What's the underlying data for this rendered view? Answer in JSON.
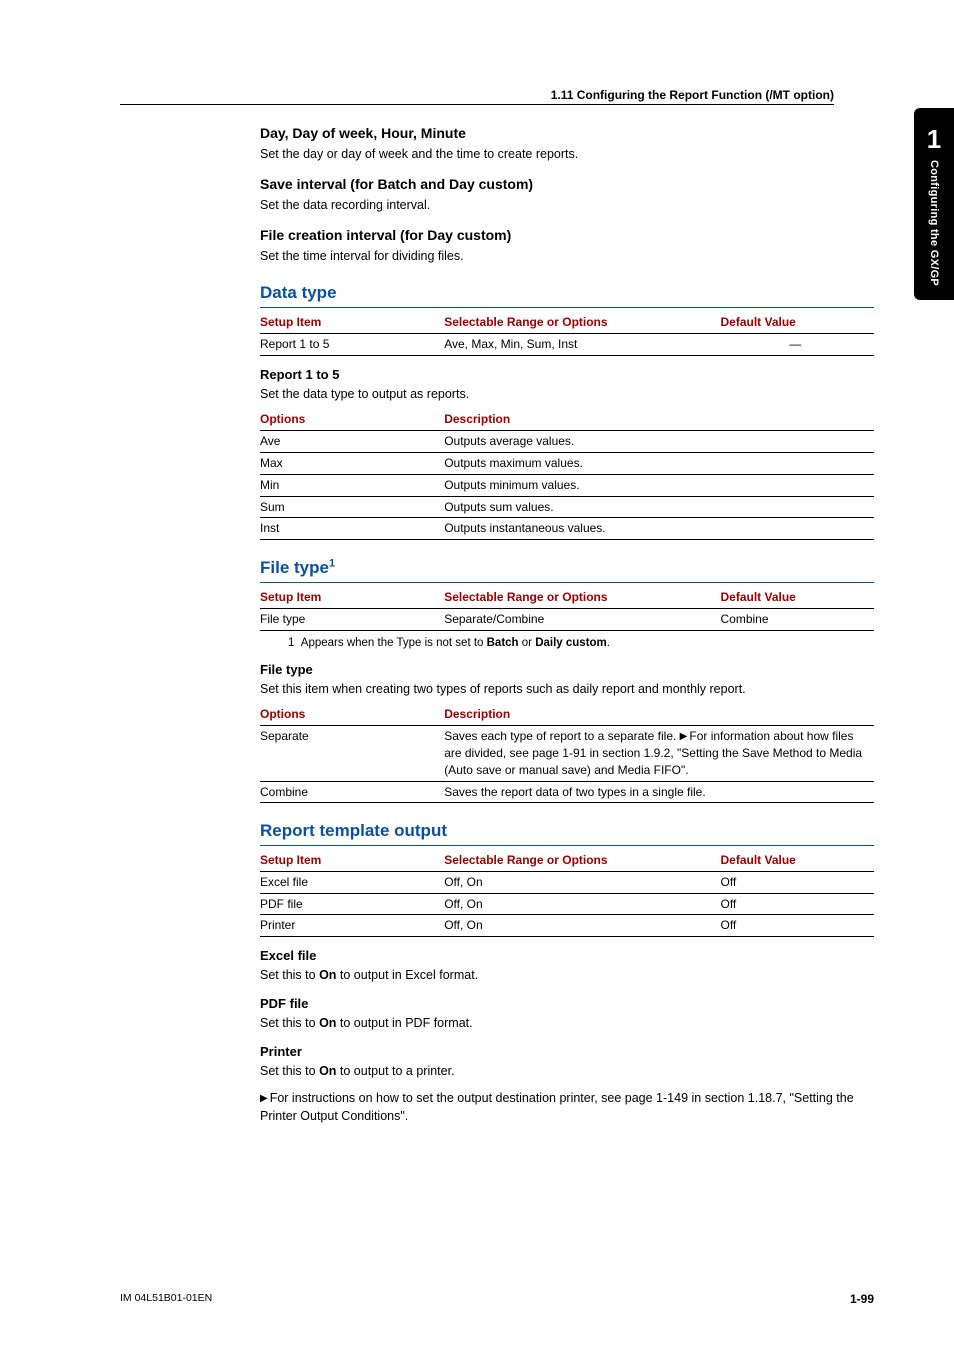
{
  "header": {
    "running": "1.11  Configuring the Report Function (/MT option)"
  },
  "sidetab": {
    "chapter": "1",
    "label": "Configuring the GX/GP"
  },
  "sections": {
    "dayhour": {
      "title": "Day, Day of week, Hour, Minute",
      "desc": "Set the day or day of week and the time to create reports."
    },
    "saveint": {
      "title": "Save interval (for Batch and Day custom)",
      "desc": "Set the data recording interval."
    },
    "fileint": {
      "title": "File creation interval (for Day custom)",
      "desc": "Set the time interval for dividing files."
    },
    "datatype": {
      "title": "Data type",
      "table_headers": {
        "setup": "Setup Item",
        "range": "Selectable Range or Options",
        "default": "Default Value"
      },
      "rows": [
        {
          "item": "Report 1 to 5",
          "range": "Ave, Max, Min, Sum, Inst",
          "default": "—"
        }
      ],
      "subhead": "Report 1 to 5",
      "subdesc": "Set the data type to output as reports.",
      "opts_headers": {
        "opt": "Options",
        "desc": "Description"
      },
      "opts": [
        {
          "o": "Ave",
          "d": "Outputs average values."
        },
        {
          "o": "Max",
          "d": "Outputs maximum values."
        },
        {
          "o": "Min",
          "d": "Outputs minimum values."
        },
        {
          "o": "Sum",
          "d": "Outputs sum values."
        },
        {
          "o": "Inst",
          "d": "Outputs instantaneous values."
        }
      ]
    },
    "filetype": {
      "title": "File type",
      "sup": "1",
      "table_headers": {
        "setup": "Setup Item",
        "range": "Selectable Range or Options",
        "default": "Default Value"
      },
      "rows": [
        {
          "item": "File type",
          "range": "Separate/Combine",
          "default": "Combine"
        }
      ],
      "footnote_prefix": "1",
      "footnote_a": "Appears when the Type is not set to ",
      "footnote_b1": "Batch",
      "footnote_mid": " or ",
      "footnote_b2": "Daily custom",
      "footnote_end": ".",
      "subhead": "File type",
      "subdesc": "Set this item when creating two types of reports such as daily report and monthly report.",
      "opts_headers": {
        "opt": "Options",
        "desc": "Description"
      },
      "opts": {
        "sep_o": "Separate",
        "sep_d1": "Saves each type of report to a separate file. ",
        "sep_d2": "For information about how files are divided, see page 1-91 in section 1.9.2, \"Setting the Save Method to Media (Auto save or manual save) and Media FIFO\".",
        "comb_o": "Combine",
        "comb_d": "Saves the report data of two types in a single file."
      }
    },
    "template": {
      "title": "Report template output",
      "table_headers": {
        "setup": "Setup Item",
        "range": "Selectable Range or Options",
        "default": "Default Value"
      },
      "rows": [
        {
          "item": "Excel file",
          "range": "Off, On",
          "default": "Off"
        },
        {
          "item": "PDF file",
          "range": "Off, On",
          "default": "Off"
        },
        {
          "item": "Printer",
          "range": "Off, On",
          "default": "Off"
        }
      ],
      "excel_head": "Excel file",
      "excel_a": "Set this to ",
      "excel_b": "On",
      "excel_c": " to output in Excel format.",
      "pdf_head": "PDF file",
      "pdf_a": "Set this to ",
      "pdf_b": "On",
      "pdf_c": " to output in PDF format.",
      "printer_head": "Printer",
      "printer_a": "Set this to ",
      "printer_b": "On",
      "printer_c": " to output to a printer.",
      "note": "For instructions on how to set the output destination printer, see page 1-149 in section 1.18.7, \"Setting the Printer Output Conditions\"."
    }
  },
  "footer": {
    "doc": "IM 04L51B01-01EN",
    "page": "1-99"
  }
}
